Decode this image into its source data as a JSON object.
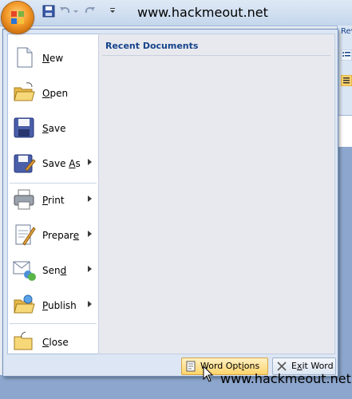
{
  "watermark": {
    "text": "www.hackmeout.net"
  },
  "window": {
    "ribbon_tab_partial": "Rev"
  },
  "quick_access": {
    "items": [
      "save-icon",
      "undo-icon",
      "redo-icon",
      "customize-icon"
    ]
  },
  "office_menu": {
    "items": [
      {
        "key": "N",
        "rest": "ew",
        "icon": "new-document-icon",
        "submenu": false
      },
      {
        "key": "O",
        "rest": "pen",
        "icon": "open-folder-icon",
        "submenu": false
      },
      {
        "key": "S",
        "rest": "ave",
        "icon": "save-disk-icon",
        "submenu": false
      },
      {
        "pre": "Save ",
        "key": "A",
        "rest": "s",
        "icon": "save-as-icon",
        "submenu": true
      },
      {
        "key": "P",
        "rest": "rint",
        "icon": "printer-icon",
        "submenu": true
      },
      {
        "pre": "Prepar",
        "key": "e",
        "rest": "",
        "icon": "prepare-icon",
        "submenu": true
      },
      {
        "pre": "Sen",
        "key": "d",
        "rest": "",
        "icon": "send-icon",
        "submenu": true
      },
      {
        "key": "P",
        "rest": "ublish",
        "pre": "",
        "icon": "publish-icon",
        "submenu": true
      },
      {
        "key": "C",
        "rest": "lose",
        "icon": "close-folder-icon",
        "submenu": false
      }
    ],
    "recent_documents_title": "Recent Documents",
    "footer": {
      "options_pre": "Word Opt",
      "options_key": "i",
      "options_rest": "ons",
      "exit_pre": "E",
      "exit_key": "x",
      "exit_rest": "it Word"
    }
  },
  "colors": {
    "accent": "#15428b",
    "menu_bg": "#dce6f4",
    "highlight": "#ffd46b"
  }
}
